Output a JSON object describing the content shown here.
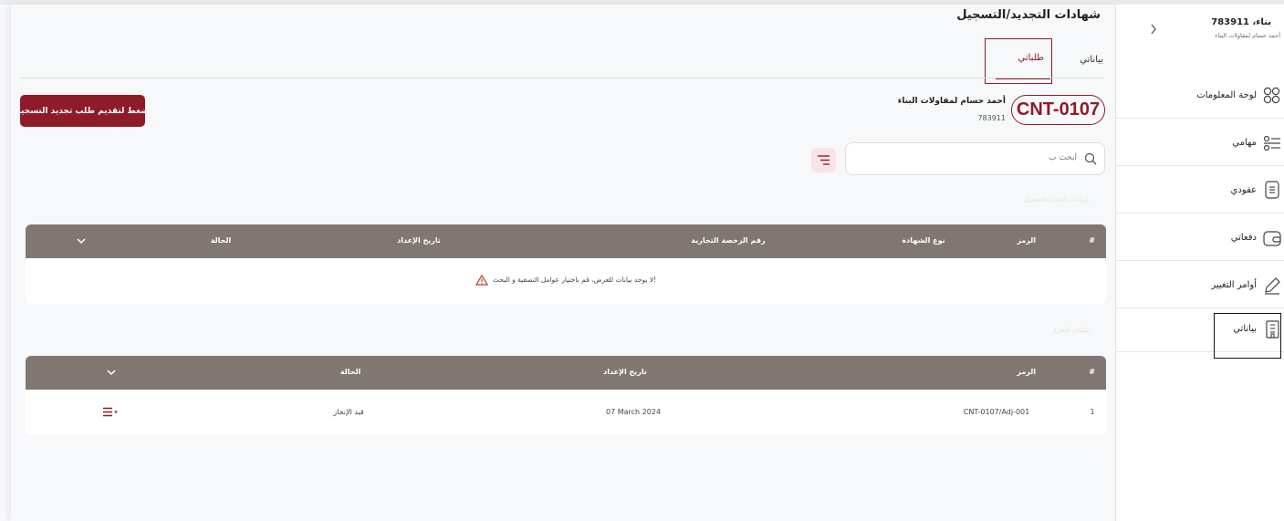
{
  "page": {
    "title": "شهادات التجديد/التسجيل"
  },
  "tabs": [
    {
      "label": "بياناتي",
      "active": false
    },
    {
      "label": "طلباتي",
      "active": true
    }
  ],
  "request_button": {
    "label": "إضغط لتقديم طلب تجديد التسجيل"
  },
  "company": {
    "code": "CNT-0107",
    "name": "أحمد حسام لمقاولات البناء",
    "id": "783911"
  },
  "search": {
    "placeholder": "ابحث ب"
  },
  "section1": {
    "label": "شهادات التجديد/التسجيل"
  },
  "table1": {
    "columns": [
      "#",
      "الرمز",
      "نوع الشهادة",
      "رقم الرخصة التجارية",
      "تاريخ الإعداد",
      "الحالة"
    ],
    "empty_message": "لا يوجد بيانات للعرض، قم باختيار عوامل التصفية و البحث!"
  },
  "section2": {
    "label": "طلبات التعديل"
  },
  "table2": {
    "columns": [
      "#",
      "الرمز",
      "تاريخ الإعداد",
      "الحالة"
    ],
    "rows": [
      {
        "index": "1",
        "code": "CNT-0107/Adj-001",
        "date": "07 March 2024",
        "status": "قيد الإنجاز"
      }
    ]
  },
  "sidebar": {
    "user_id": "783911 ،بناء",
    "user_sub": "أحمد حسام لمقاولات البناء",
    "items": [
      {
        "label": "لوحة المعلومات",
        "icon": "dashboard-icon"
      },
      {
        "label": "مهامي",
        "icon": "tasks-icon"
      },
      {
        "label": "عقودي",
        "icon": "contract-icon"
      },
      {
        "label": "دفعاتي",
        "icon": "wallet-icon"
      },
      {
        "label": "أوامر التغيير",
        "icon": "edit-icon"
      },
      {
        "label": "بياناتي",
        "icon": "building-icon",
        "active": true
      }
    ]
  },
  "colors": {
    "brand": "#8e1b2a",
    "table_header": "#807773"
  }
}
